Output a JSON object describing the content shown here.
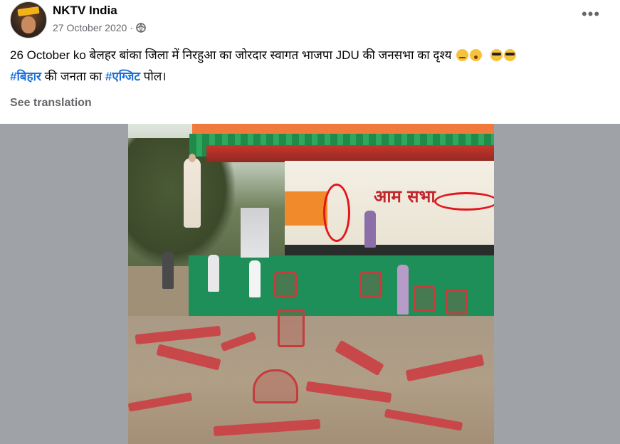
{
  "post": {
    "page_name": "NKTV India",
    "date": "27 October 2020",
    "separator": "·",
    "privacy_icon": "globe-icon",
    "more_icon": "more-options-icon",
    "more_label": "•••",
    "caption": {
      "line1_text": "26 October ko बेलहर बांका जिला में निरहुआ का जोरदार स्वागत भाजपा JDU की जनसभा का दृश्य",
      "emojis_line1": [
        "wink-face-emoji",
        "astonished-face-emoji",
        "sunglasses-face-emoji",
        "sunglasses-face-emoji"
      ],
      "hashtag1": "#बिहार",
      "line2_mid": " की जनता का ",
      "hashtag2": "#एग्जिट",
      "line2_end": " पोल।"
    },
    "see_translation": "See translation",
    "image": {
      "banner_text": "आम सभा",
      "annotation_color": "#e3151c"
    }
  },
  "colors": {
    "hashtag": "#1b6fd8",
    "meta_text": "#65676b",
    "media_background": "#9fa3a8"
  }
}
